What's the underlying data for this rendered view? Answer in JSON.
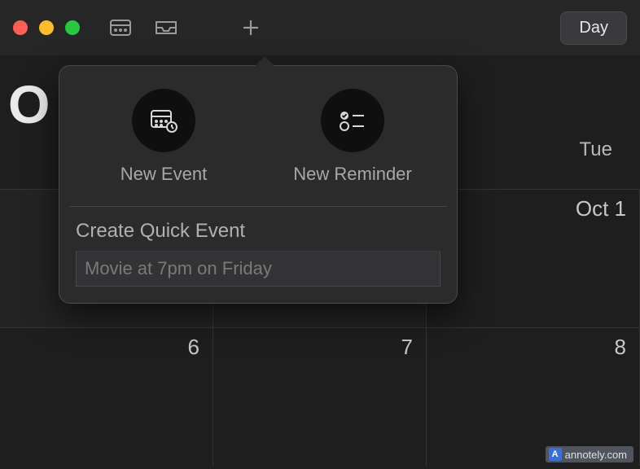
{
  "toolbar": {
    "view_button_label": "Day"
  },
  "month_visible_letter": "O",
  "popover": {
    "options": {
      "new_event_label": "New Event",
      "new_reminder_label": "New Reminder"
    },
    "quick_event_heading": "Create Quick Event",
    "quick_event_placeholder": "Movie at 7pm on Friday",
    "quick_event_value": ""
  },
  "calendar": {
    "day_heading": "Tue",
    "row1": {
      "c1": "",
      "c2": "",
      "c3": "Oct 1"
    },
    "row2": {
      "c1": "6",
      "c2": "7",
      "c3": "8"
    }
  },
  "watermark_text": "annotely.com",
  "annotation": {
    "highlighted_option": "new-reminder"
  }
}
